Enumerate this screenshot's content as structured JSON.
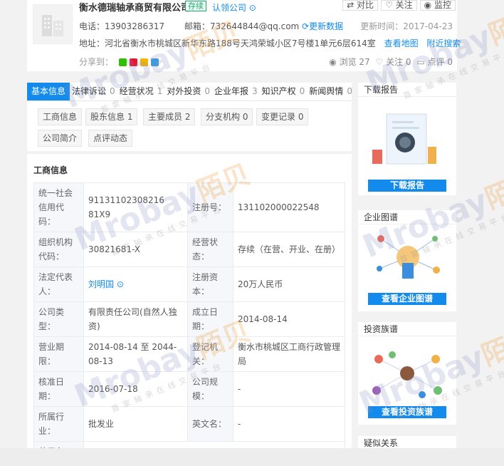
{
  "header": {
    "company_name": "衡水德瑞轴承商贸有限公司",
    "status_tag": "存续",
    "claim_label": "认领公司",
    "buttons": [
      "对比",
      "关注",
      "监控"
    ],
    "phone_label": "电话：",
    "phone": "13903286317",
    "email_label": "邮箱：",
    "email": "732644844@qq.com",
    "more_label": "更新数据",
    "updated_label": "更新时间：",
    "updated": "2017-04-23",
    "address_label": "地址：",
    "address": "河北省衡水市桃城区新华东路188号天鸿荣城小区7号楼1单元6层614室",
    "map_label": "查看地图",
    "nearby_label": "附近搜索",
    "share_label": "分享到：",
    "views": "浏览 27",
    "follows": "关注 0",
    "comments": "点评 0"
  },
  "tabs": [
    {
      "label": "基本信息",
      "count": ""
    },
    {
      "label": "法律诉讼",
      "count": "0"
    },
    {
      "label": "经营状况",
      "count": "1"
    },
    {
      "label": "对外投资",
      "count": "0"
    },
    {
      "label": "企业年报",
      "count": "3"
    },
    {
      "label": "知识产权",
      "count": "0"
    },
    {
      "label": "新闻舆情",
      "count": "0"
    }
  ],
  "subtabs": [
    "工商信息",
    "股东信息 1",
    "主要成员 2",
    "分支机构 0",
    "变更记录 0",
    "公司简介",
    "点评动态"
  ],
  "section_title": "工商信息",
  "fields": {
    "credit_code_label": "统一社会信用代码：",
    "credit_code": "91131102308216 81X9",
    "reg_no_label": "注册号：",
    "reg_no": "131102000022548",
    "org_code_label": "组织机构代码：",
    "org_code": "30821681-X",
    "biz_status_label": "经营状态：",
    "biz_status": "存续（在营、开业、在册）",
    "legal_rep_label": "法定代表人：",
    "legal_rep": "刘明国",
    "capital_label": "注册资本：",
    "capital": "20万人民币",
    "type_label": "公司类型：",
    "type": "有限责任公司(自然人独资)",
    "est_label": "成立日期：",
    "est": "2014-08-14",
    "term_label": "营业期限：",
    "term": "2014-08-14 至 2044-08-13",
    "authority_label": "登记机关：",
    "authority": "衡水市桃城区工商行政管理局",
    "approve_label": "核准日期：",
    "approve": "2016-07-18",
    "scale_label": "公司规模：",
    "scale": "-",
    "industry_label": "所属行业：",
    "industry": "批发业",
    "en_label": "英文名：",
    "en": "-",
    "former_label": "曾用名：",
    "former": "-"
  },
  "sidebar": {
    "report_title": "下载报告",
    "report_btn": "下载报告",
    "graph_title": "企业图谱",
    "graph_btn": "查看企业图谱",
    "invest_title": "投资族谱",
    "invest_btn": "查看投资族谱",
    "related_title": "疑似关系"
  },
  "watermark": {
    "brand": "Mrobay",
    "cn": "陌贝",
    "slogan": "首家轴承在线交易平台"
  },
  "colors": {
    "accent": "#128bed",
    "status": "#1aa86a"
  }
}
